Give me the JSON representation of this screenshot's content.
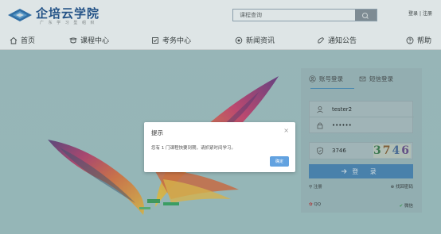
{
  "header": {
    "logo_text": "企培云学院",
    "logo_sub": "广 东 学 习 型 组 织",
    "search_placeholder": "课程查询",
    "login_link": "登录",
    "separator": "|",
    "register_link": "注册"
  },
  "nav": {
    "items": [
      {
        "label": "首页",
        "icon": "home-icon"
      },
      {
        "label": "课程中心",
        "icon": "course-icon"
      },
      {
        "label": "考务中心",
        "icon": "exam-icon"
      },
      {
        "label": "新闻资讯",
        "icon": "news-icon"
      },
      {
        "label": "通知公告",
        "icon": "notice-icon"
      },
      {
        "label": "帮助",
        "icon": "help-icon"
      }
    ]
  },
  "login": {
    "tab_account": "账号登录",
    "tab_sms": "短信登录",
    "username_value": "tester2",
    "password_value": "••••••",
    "captcha_value": "3746",
    "captcha_chars": [
      "3",
      "7",
      "4",
      "6"
    ],
    "submit_label": "登 录",
    "register_link": "注册",
    "forgot_link": "找回密码",
    "qq_label": "QQ",
    "wechat_label": "微信"
  },
  "dialog": {
    "title": "提示",
    "message": "您有 1 门课程快要到期，请抓紧时间学习。",
    "confirm_label": "确定",
    "close_symbol": "×"
  },
  "colors": {
    "accent": "#4a86b8",
    "confirm": "#62a2e0",
    "brand": "#1d4e8c"
  }
}
